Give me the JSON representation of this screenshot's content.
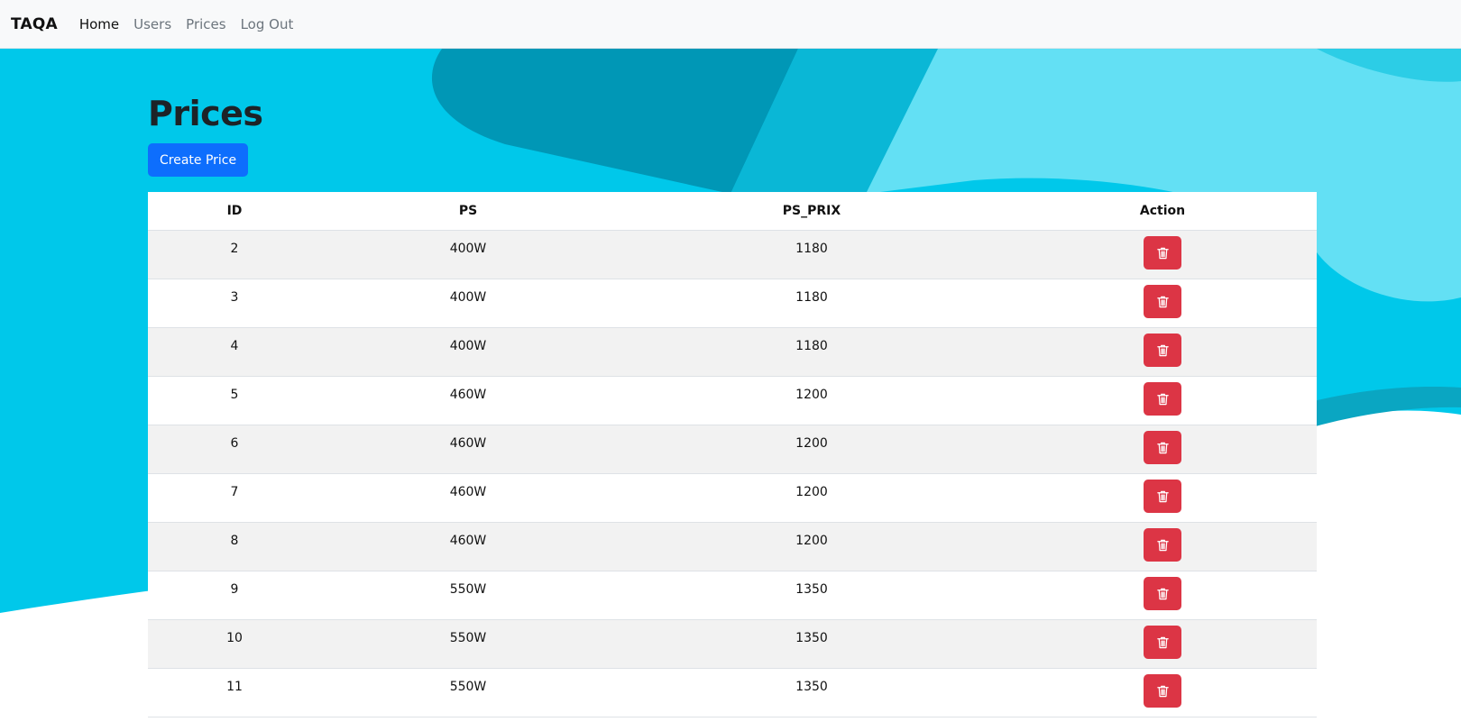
{
  "navbar": {
    "brand": "TAQA",
    "links": [
      {
        "label": "Home",
        "active": true
      },
      {
        "label": "Users",
        "active": false
      },
      {
        "label": "Prices",
        "active": false
      },
      {
        "label": "Log Out",
        "active": false
      }
    ]
  },
  "page": {
    "title": "Prices",
    "create_button_label": "Create Price"
  },
  "table": {
    "headers": [
      "ID",
      "PS",
      "PS_PRIX",
      "Action"
    ],
    "rows": [
      {
        "id": "2",
        "ps": "400W",
        "ps_prix": "1180",
        "action_icon": "trash-icon"
      },
      {
        "id": "3",
        "ps": "400W",
        "ps_prix": "1180",
        "action_icon": "trash-icon"
      },
      {
        "id": "4",
        "ps": "400W",
        "ps_prix": "1180",
        "action_icon": "trash-icon"
      },
      {
        "id": "5",
        "ps": "460W",
        "ps_prix": "1200",
        "action_icon": "trash-icon"
      },
      {
        "id": "6",
        "ps": "460W",
        "ps_prix": "1200",
        "action_icon": "trash-icon"
      },
      {
        "id": "7",
        "ps": "460W",
        "ps_prix": "1200",
        "action_icon": "trash-icon"
      },
      {
        "id": "8",
        "ps": "460W",
        "ps_prix": "1200",
        "action_icon": "trash-icon"
      },
      {
        "id": "9",
        "ps": "550W",
        "ps_prix": "1350",
        "action_icon": "trash-icon"
      },
      {
        "id": "10",
        "ps": "550W",
        "ps_prix": "1350",
        "action_icon": "trash-icon"
      },
      {
        "id": "11",
        "ps": "550W",
        "ps_prix": "1350",
        "action_icon": "trash-icon"
      }
    ]
  },
  "colors": {
    "primary": "#0d6efd",
    "danger": "#dc3545",
    "background_accent": "#00c8ea"
  }
}
